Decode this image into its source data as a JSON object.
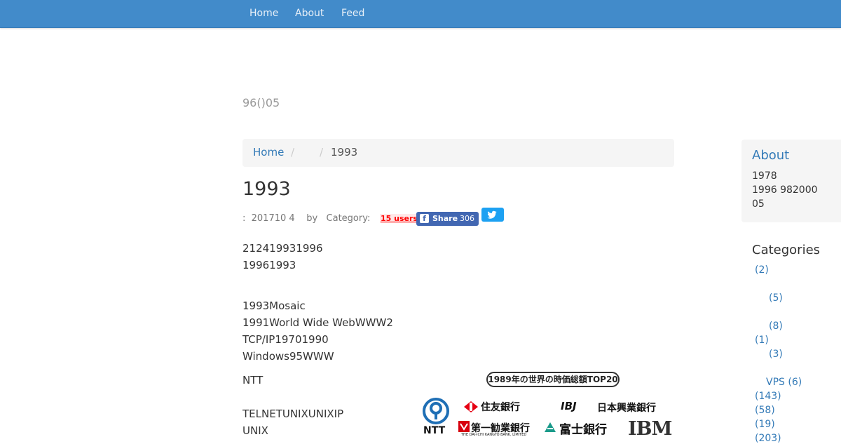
{
  "nav": {
    "home": "Home",
    "about": "About",
    "feed": "Feed"
  },
  "site_description": "96()05",
  "breadcrumb": {
    "home": "Home",
    "separator": "/",
    "current": "1993"
  },
  "post": {
    "title": "1993",
    "meta": ":  201710 4    by   Category:",
    "hatena_label": "15 users",
    "fb_label": "Share",
    "fb_count": "306",
    "paragraphs": [
      "212419931996",
      "19961993",
      "1993Mosaic",
      "1991World Wide WebWWW2",
      "TCP/IP19701990",
      "Windows95WWW",
      "NTT",
      "TELNETUNIXUNIXIP",
      "UNIX"
    ]
  },
  "embedded_image": {
    "title": "1989年の世界の時価総額TOP20",
    "logos": {
      "ntt": "NTT",
      "sumitomo": "住友銀行",
      "ibj_mark": "IBJ",
      "ibj_name": "日本興業銀行",
      "dkb": "第一勧業銀行",
      "dkb_sub": "THE DAI-ICHI KANGYO BANK, LIMITED",
      "fuji": "富士銀行",
      "ibm": "IBM"
    },
    "colors": {
      "ntt_blue": "#1f6fb5",
      "sumitomo_red": "#e60012",
      "dkb_red": "#d7000f",
      "fuji_teal": "#1a9a8a"
    }
  },
  "sidebar": {
    "about_title": "About",
    "about_lines": [
      "1978",
      "1996 982000",
      "05"
    ],
    "categories_title": "Categories",
    "categories": [
      "(2)",
      "(5)",
      "(8)",
      "(1)",
      "(3)",
      "VPS (6)",
      "(143)",
      "(58)",
      "(19)",
      "(203)"
    ]
  },
  "colors": {
    "navbar": "#428bca",
    "link": "#337ab7",
    "fb": "#4267b2",
    "twitter": "#1da1f2",
    "hatena": "#ff0000"
  }
}
